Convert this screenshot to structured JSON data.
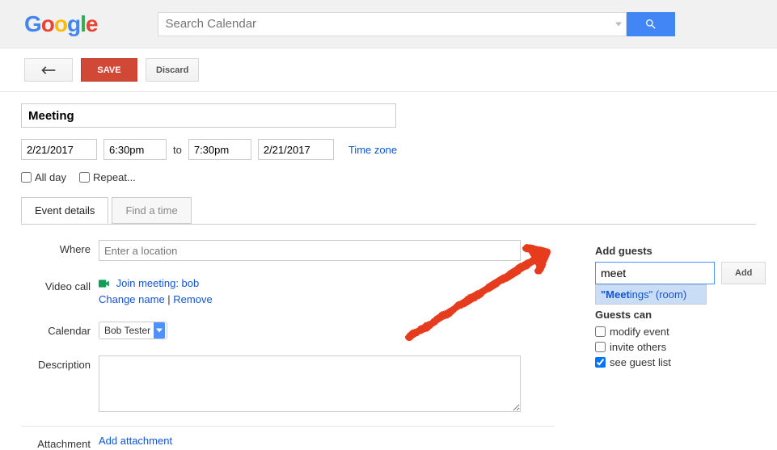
{
  "search": {
    "placeholder": "Search Calendar"
  },
  "actions": {
    "save": "SAVE",
    "discard": "Discard"
  },
  "event": {
    "title": "Meeting",
    "start_date": "2/21/2017",
    "start_time": "6:30pm",
    "to": "to",
    "end_time": "7:30pm",
    "end_date": "2/21/2017",
    "timezone_link": "Time zone",
    "all_day": "All day",
    "repeat": "Repeat..."
  },
  "tabs": {
    "details": "Event details",
    "find": "Find a time"
  },
  "where": {
    "label": "Where",
    "placeholder": "Enter a location"
  },
  "video": {
    "label": "Video call",
    "join": "Join meeting: bob",
    "change": "Change name",
    "sep": " | ",
    "remove": "Remove"
  },
  "calendar": {
    "label": "Calendar",
    "value": "Bob Tester"
  },
  "description": {
    "label": "Description"
  },
  "attachment": {
    "label": "Attachment",
    "link": "Add attachment"
  },
  "guests": {
    "title": "Add guests",
    "input": "meet",
    "add": "Add",
    "suggestion_match": "\"Meet",
    "suggestion_rest": "ings\" (room)"
  },
  "perms": {
    "title": "Guests can",
    "modify": "modify event",
    "invite": "invite others",
    "see": "see guest list"
  }
}
